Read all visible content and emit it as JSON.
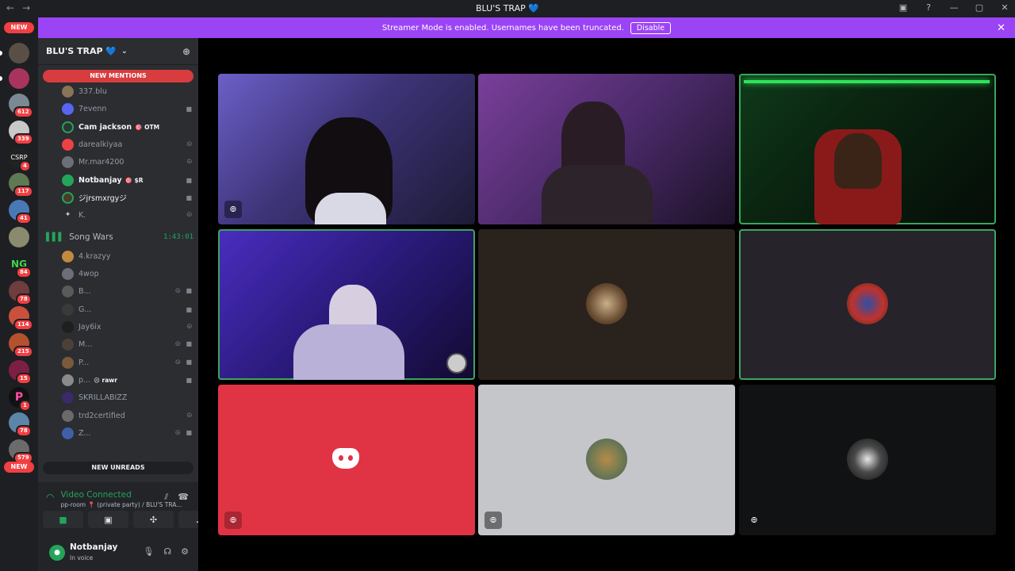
{
  "titlebar": {
    "title": "BLU'S TRAP 💙",
    "back": "←",
    "forward": "→",
    "icons": [
      "inbox-icon",
      "help-icon",
      "minimize-icon",
      "maximize-icon",
      "close-icon"
    ]
  },
  "rail": {
    "new_top": "NEW",
    "new_bottom": "NEW",
    "badges": [
      "612",
      "339",
      "4",
      "117",
      "41",
      "84",
      "78",
      "114",
      "215",
      "15",
      "1",
      "78",
      "579"
    ]
  },
  "banner": {
    "text": "Streamer Mode is enabled. Usernames have been truncated.",
    "button": "Disable"
  },
  "server": {
    "name": "BLU'S TRAP 💙"
  },
  "pills": {
    "mentions": "NEW MENTIONS",
    "unreads": "NEW UNREADS"
  },
  "voice_users_top": [
    {
      "name": "337.blu"
    },
    {
      "name": "7evenn"
    },
    {
      "name": "Cam jackson",
      "tag": "🎯 OTM"
    },
    {
      "name": "darealkiyaa"
    },
    {
      "name": "Mr.mar4200"
    },
    {
      "name": "Notbanjay",
      "tag": "🎯 $R"
    },
    {
      "name": "ジjrsmxrgyジ"
    },
    {
      "name": "K."
    }
  ],
  "channel": {
    "name": "Song Wars",
    "timer": "1:43:01"
  },
  "voice_users_bottom": [
    {
      "name": "4.krazyy"
    },
    {
      "name": "4wop"
    },
    {
      "name": "B..."
    },
    {
      "name": "G..."
    },
    {
      "name": "Jay6ix"
    },
    {
      "name": "M..."
    },
    {
      "name": "P..."
    },
    {
      "name": "p...",
      "tag": "☹ rawr"
    },
    {
      "name": "SKRILLABIZZ"
    },
    {
      "name": "trd2certified"
    },
    {
      "name": "Z..."
    }
  ],
  "voice_panel": {
    "status": "Video Connected",
    "location": "pp-room 📍 (private party) / BLU'S TRA..."
  },
  "user": {
    "name": "Notbanjay",
    "status": "In voice"
  },
  "colors": {
    "banner": "#9b44f5",
    "speaking": "#3ba55d",
    "discord_red": "#e03445"
  }
}
